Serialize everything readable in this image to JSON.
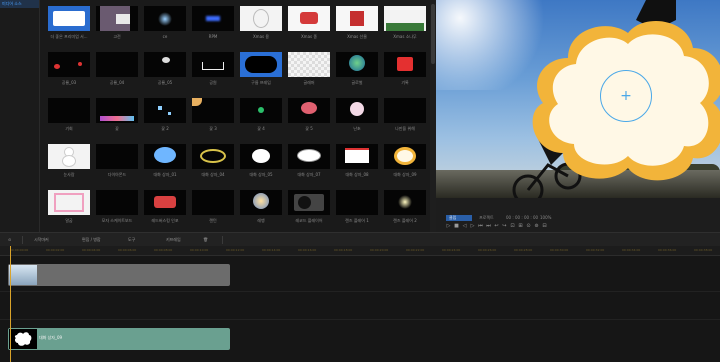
{
  "tree": {
    "items": [
      "미디어 소스",
      "",
      "",
      "",
      "",
      "",
      "",
      "",
      "",
      "",
      "",
      "",
      "",
      "",
      "",
      "",
      "",
      "",
      "",
      ""
    ],
    "selected_index": 0
  },
  "assets": [
    {
      "label": "더 좋은 프리미엄 서...",
      "kind": "banner"
    },
    {
      "label": "고전",
      "kind": "glitch"
    },
    {
      "label": "ce",
      "kind": "burst"
    },
    {
      "label": "RPM",
      "kind": "blueglow"
    },
    {
      "label": "Xmas 용",
      "kind": "ornament"
    },
    {
      "label": "Xmas 종",
      "kind": "xmas"
    },
    {
      "label": "Xmas 선물",
      "kind": "gift"
    },
    {
      "label": "Xmas 소나무",
      "kind": "pine"
    },
    {
      "label": "공룡_03",
      "kind": "redspots"
    },
    {
      "label": "공룡_04",
      "kind": "dark"
    },
    {
      "label": "공룡_05",
      "kind": "darkflare"
    },
    {
      "label": "공원",
      "kind": "doodle"
    },
    {
      "label": "구름 프레임",
      "kind": "cloudframe"
    },
    {
      "label": "글래머",
      "kind": "checker"
    },
    {
      "label": "글로벌",
      "kind": "globe"
    },
    {
      "label": "기록",
      "kind": "rec"
    },
    {
      "label": "기회",
      "kind": "dark"
    },
    {
      "label": "꽃",
      "kind": "flowers"
    },
    {
      "label": "꽃 2",
      "kind": "sparkle"
    },
    {
      "label": "꽃 3",
      "kind": "cornerflower"
    },
    {
      "label": "꽃 4",
      "kind": "leaf"
    },
    {
      "label": "꽃 5",
      "kind": "rose"
    },
    {
      "label": "난초",
      "kind": "orchid"
    },
    {
      "label": "나만을 위해",
      "kind": "dark"
    },
    {
      "label": "눈사람",
      "kind": "snowman"
    },
    {
      "label": "다이아몬드",
      "kind": "dark"
    },
    {
      "label": "대화 상자_01",
      "kind": "bubbleblue"
    },
    {
      "label": "대화 상자_04",
      "kind": "ring"
    },
    {
      "label": "대화 상자_05",
      "kind": "bubblewhite"
    },
    {
      "label": "대화 상자_07",
      "kind": "bubbleoval"
    },
    {
      "label": "대화 상자_08",
      "kind": "note"
    },
    {
      "label": "대화 상자_09",
      "kind": "bubblecloud"
    },
    {
      "label": "말굽",
      "kind": "pinkframe"
    },
    {
      "label": "모자 스케이트보드",
      "kind": "dark"
    },
    {
      "label": "레드버스킹 인포",
      "kind": "redshape"
    },
    {
      "label": "랜턴",
      "kind": "dark"
    },
    {
      "label": "레뱅",
      "kind": "ball"
    },
    {
      "label": "레코드 플레이어",
      "kind": "turntable"
    },
    {
      "label": "렌즈 플레어 1",
      "kind": "dark"
    },
    {
      "label": "렌즈 플레어 2",
      "kind": "flare"
    }
  ],
  "preview": {
    "plus_symbol": "+"
  },
  "playback": {
    "tab_clip": "클립",
    "tab_project": "프로젝트",
    "timecode": "00 : 00 : 00 : 00",
    "zoom": "100%",
    "controls": [
      "▷",
      "■",
      "◁",
      "▷",
      "⏮",
      "⏭",
      "↩",
      "↪",
      "⊡",
      "⊞",
      "⊙",
      "⊚",
      "⊟"
    ]
  },
  "toolbar": {
    "items": [
      "⊙",
      "시작마커",
      "편집 / 병합",
      "도구",
      "키프레임",
      "🗑"
    ]
  },
  "ruler": {
    "ticks": [
      "00:00:00:00",
      "00:00:02:00",
      "00:00:04:00",
      "00:00:06:00",
      "00:00:08:00",
      "00:00:10:00",
      "00:00:12:00",
      "00:00:14:00",
      "00:00:16:00",
      "00:00:18:00",
      "00:00:20:00",
      "00:00:22:00",
      "00:00:24:00",
      "00:00:26:00",
      "00:00:28:00",
      "00:00:30:00",
      "00:00:32:00",
      "00:00:34:00",
      "00:00:36:00",
      "00:00:38:00"
    ]
  },
  "timeline": {
    "video_clip_label": "",
    "sticker_clip_label": "대화 상자_09"
  }
}
